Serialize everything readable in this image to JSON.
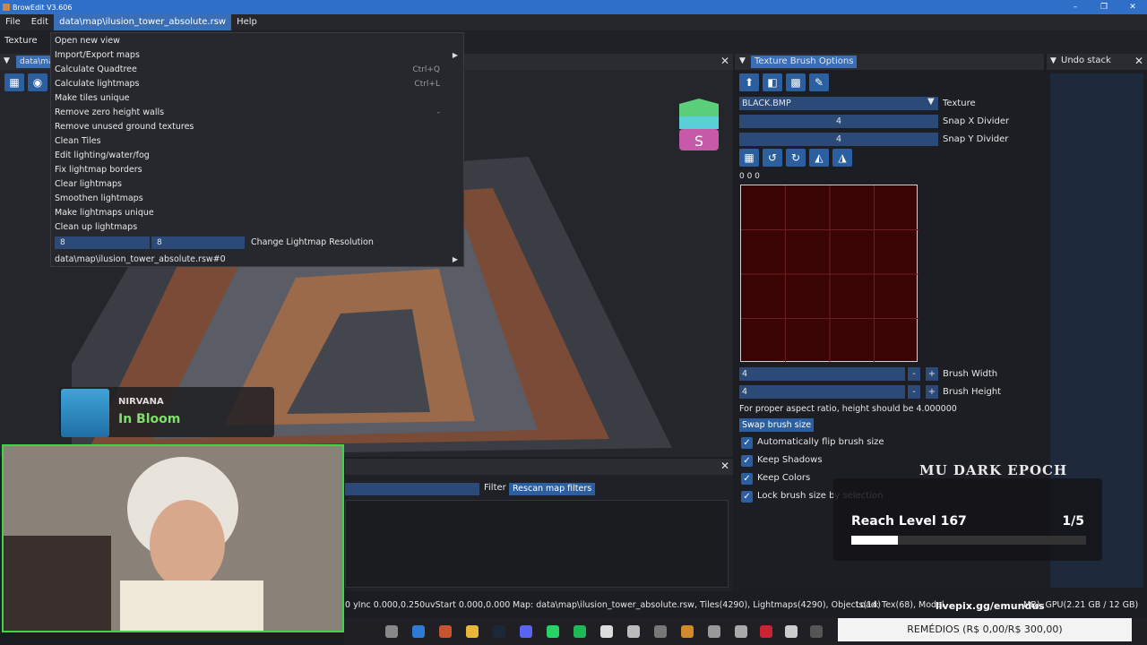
{
  "window": {
    "title": "BrowEdit V3.606",
    "controls": [
      "–",
      "❐",
      "✕"
    ]
  },
  "menubar": {
    "items": [
      "File",
      "Edit",
      "data\\map\\ilusion_tower_absolute.rsw",
      "Help"
    ]
  },
  "toolbar": {
    "texture_label": "Texture"
  },
  "viewport": {
    "tab_label": "data\\ma"
  },
  "dropdown": {
    "items": [
      {
        "label": "Open new view",
        "shortcut": ""
      },
      {
        "label": "Import/Export maps",
        "shortcut": "",
        "submenu": true
      },
      {
        "label": "Calculate Quadtree",
        "shortcut": "Ctrl+Q"
      },
      {
        "label": "Calculate lightmaps",
        "shortcut": "Ctrl+L"
      },
      {
        "label": "Make tiles unique",
        "shortcut": ""
      },
      {
        "label": "Remove zero height walls",
        "shortcut": "-"
      },
      {
        "label": "Remove unused ground textures",
        "shortcut": ""
      },
      {
        "label": "Clean Tiles",
        "shortcut": ""
      },
      {
        "label": "Edit lighting/water/fog",
        "shortcut": ""
      },
      {
        "label": "Fix lightmap borders",
        "shortcut": ""
      },
      {
        "label": "Clear lightmaps",
        "shortcut": ""
      },
      {
        "label": "Smoothen lightmaps",
        "shortcut": ""
      },
      {
        "label": "Make lightmaps unique",
        "shortcut": ""
      },
      {
        "label": "Clean up lightmaps",
        "shortcut": ""
      }
    ],
    "lightmap_res_x": "8",
    "lightmap_res_y": "8",
    "change_res_label": "Change Lightmap Resolution",
    "view_entry": "data\\map\\ilusion_tower_absolute.rsw#0"
  },
  "console": {
    "filter_label": "Filter",
    "rescan_label": "Rescan map filters"
  },
  "statusbar": {
    "yinc": "0 yInc 0.000,0.250",
    "uvstart": "uvStart 0.000,0.000",
    "map_info": "Map: data\\map\\ilusion_tower_absolute.rsw, Tiles(4290), Lightmaps(4290), Objects(14)",
    "load_info": "Load: Tex(68), Model",
    "gpu_info": "MB), GPU(2.21 GB / 12 GB)"
  },
  "texture_brush": {
    "title": "Texture Brush Options",
    "texture_value": "BLACK.BMP",
    "texture_label": "Texture",
    "snap_x_value": "4",
    "snap_x_label": "Snap X Divider",
    "snap_y_value": "4",
    "snap_y_label": "Snap Y Divider",
    "coords": "0 0 0",
    "brush_width_value": "4",
    "brush_width_label": "Brush Width",
    "brush_height_value": "4",
    "brush_height_label": "Brush Height",
    "aspect_note": "For proper aspect ratio, height should be 4.000000",
    "swap_label": "Swap brush size",
    "checkboxes": [
      {
        "label": "Automatically flip brush size",
        "checked": true
      },
      {
        "label": "Keep Shadows",
        "checked": true
      },
      {
        "label": "Keep Colors",
        "checked": true
      },
      {
        "label": "Lock brush size by selection",
        "checked": true
      }
    ],
    "grid_color": "#3b0404"
  },
  "undo": {
    "title": "Undo stack"
  },
  "nowplaying": {
    "artist": "NIRVANA",
    "song": "In Bloom"
  },
  "goal": {
    "logo": "MU DARK EPOCH",
    "title": "Reach Level 167",
    "count": "1/5",
    "progress": 0.2
  },
  "livepix": "livepix.gg/emundus",
  "donation": "REMÉDIOS (R$ 0,00/R$ 300,00)"
}
